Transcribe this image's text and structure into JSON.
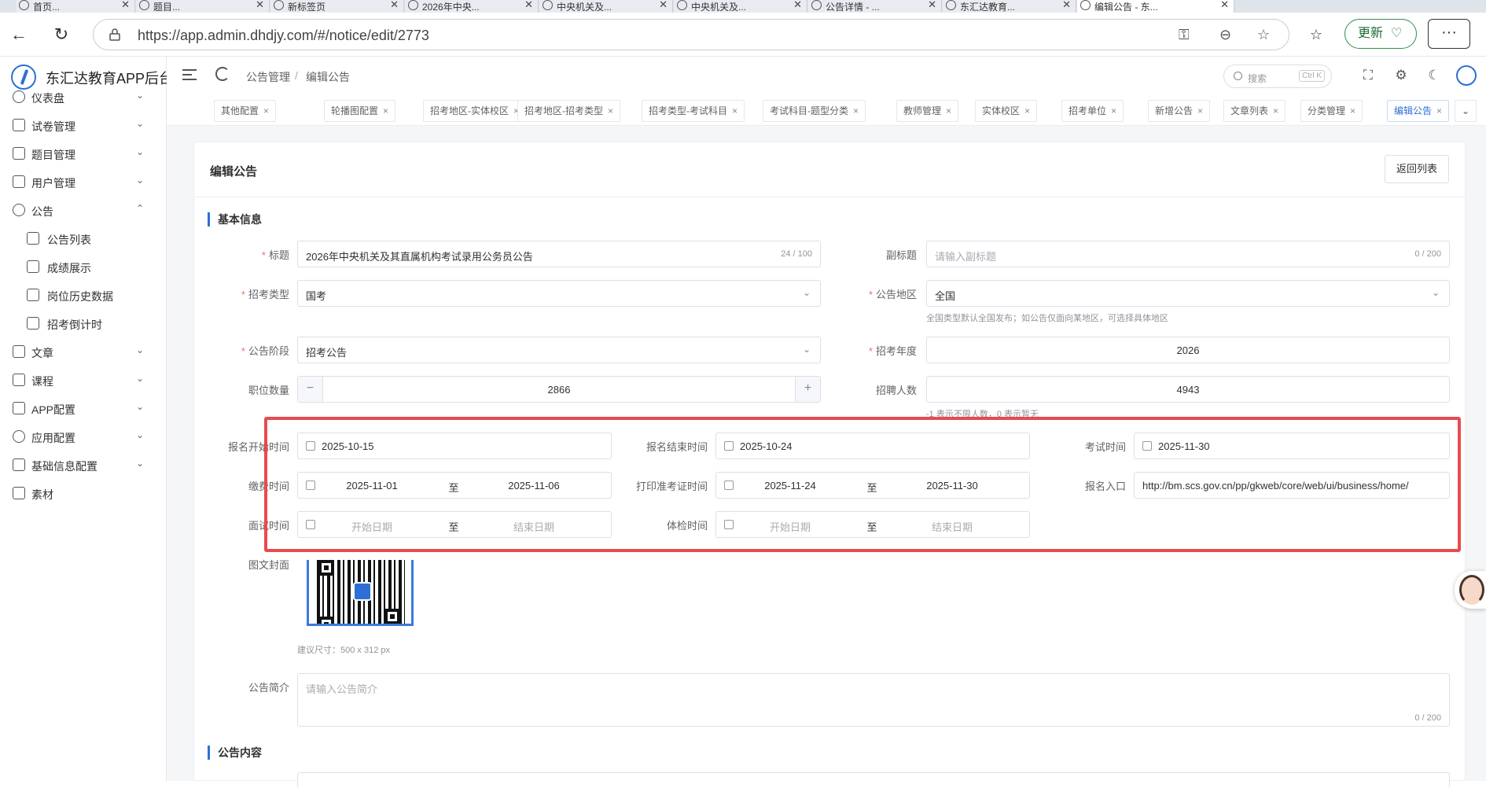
{
  "browser": {
    "tabs": [
      {
        "title": "首页..."
      },
      {
        "title": "题目..."
      },
      {
        "title": "新标签页"
      },
      {
        "title": "2026年中央..."
      },
      {
        "title": "中央机关及..."
      },
      {
        "title": "中央机关及..."
      },
      {
        "title": "公告详情 - ..."
      },
      {
        "title": "东汇达教育..."
      },
      {
        "title": "编辑公告 - 东..."
      }
    ],
    "url": "https://app.admin.dhdjy.com/#/notice/edit/2773",
    "update_label": "更新",
    "more_label": "···"
  },
  "app": {
    "title": "东汇达教育APP后台"
  },
  "sidebar": {
    "items": [
      {
        "label": "仪表盘",
        "icon": "dashboard-icon",
        "chevron": "⌄"
      },
      {
        "label": "试卷管理",
        "icon": "paper-icon",
        "chevron": "⌄"
      },
      {
        "label": "题目管理",
        "icon": "book-icon",
        "chevron": "⌄"
      },
      {
        "label": "用户管理",
        "icon": "user-icon",
        "chevron": "⌄"
      },
      {
        "label": "公告",
        "icon": "bell-icon",
        "chevron": "⌃"
      },
      {
        "label": "公告列表",
        "icon": "list-icon",
        "sub": true
      },
      {
        "label": "成绩展示",
        "icon": "trophy-icon",
        "sub": true
      },
      {
        "label": "岗位历史数据",
        "icon": "chart-icon",
        "sub": true
      },
      {
        "label": "招考倒计时",
        "icon": "sliders-icon",
        "sub": true
      },
      {
        "label": "文章",
        "icon": "article-icon",
        "chevron": "⌄"
      },
      {
        "label": "课程",
        "icon": "course-icon",
        "chevron": "⌄"
      },
      {
        "label": "APP配置",
        "icon": "user-config-icon",
        "chevron": "⌄"
      },
      {
        "label": "应用配置",
        "icon": "gear-icon",
        "chevron": "⌄"
      },
      {
        "label": "基础信息配置",
        "icon": "grid-icon",
        "chevron": "⌄"
      },
      {
        "label": "素材",
        "icon": "image-icon"
      }
    ]
  },
  "header": {
    "breadcrumb": [
      "公告管理",
      "编辑公告"
    ],
    "breadcrumb_sep": "/",
    "search_placeholder": "搜索",
    "search_shortcut": "Ctrl K"
  },
  "tags": [
    {
      "label": "其他配置"
    },
    {
      "label": "轮播图配置"
    },
    {
      "label": "招考地区-实体校区"
    },
    {
      "label": "招考地区-招考类型"
    },
    {
      "label": "招考类型-考试科目"
    },
    {
      "label": "考试科目-题型分类"
    },
    {
      "label": "教师管理"
    },
    {
      "label": "实体校区"
    },
    {
      "label": "招考单位"
    },
    {
      "label": "新增公告"
    },
    {
      "label": "文章列表"
    },
    {
      "label": "分类管理"
    },
    {
      "label": "编辑公告",
      "active": true
    }
  ],
  "card": {
    "title": "编辑公告",
    "back_label": "返回列表"
  },
  "sections": {
    "basic": "基本信息",
    "content": "公告内容"
  },
  "form": {
    "title": {
      "label": "标题",
      "value": "2026年中央机关及其直属机构考试录用公务员公告",
      "count": "24 / 100"
    },
    "subtitle": {
      "label": "副标题",
      "placeholder": "请输入副标题",
      "count": "0 / 200"
    },
    "exam_type": {
      "label": "招考类型",
      "value": "国考"
    },
    "region": {
      "label": "公告地区",
      "value": "全国",
      "hint": "全国类型默认全国发布；如公告仅面向某地区，可选择具体地区"
    },
    "stage": {
      "label": "公告阶段",
      "value": "招考公告"
    },
    "year": {
      "label": "招考年度",
      "value": "2026"
    },
    "positions": {
      "label": "职位数量",
      "value": "2866",
      "minus": "−",
      "plus": "+"
    },
    "recruits": {
      "label": "招聘人数",
      "value": "4943",
      "hint": "-1 表示不限人数，0 表示暂无"
    },
    "reg_start": {
      "label": "报名开始时间",
      "value": "2025-10-15"
    },
    "reg_end": {
      "label": "报名结束时间",
      "value": "2025-10-24"
    },
    "exam_time": {
      "label": "考试时间",
      "value": "2025-11-30"
    },
    "payment": {
      "label": "缴费时间",
      "start": "2025-11-01",
      "to": "至",
      "end": "2025-11-06"
    },
    "admit_print": {
      "label": "打印准考证时间",
      "start": "2025-11-24",
      "to": "至",
      "end": "2025-11-30"
    },
    "reg_entry": {
      "label": "报名入口",
      "value": "http://bm.scs.gov.cn/pp/gkweb/core/web/ui/business/home/"
    },
    "interview": {
      "label": "面试时间",
      "start_ph": "开始日期",
      "to": "至",
      "end_ph": "结束日期"
    },
    "physical": {
      "label": "体检时间",
      "start_ph": "开始日期",
      "to": "至",
      "end_ph": "结束日期"
    },
    "cover": {
      "label": "图文封面",
      "hint": "建议尺寸：500 x 312 px"
    },
    "summary": {
      "label": "公告简介",
      "placeholder": "请输入公告简介",
      "count": "0 / 200"
    }
  },
  "colors": {
    "accent": "#2d6fd6",
    "highlight": "#e84a4f",
    "required": "#f56c6c"
  }
}
